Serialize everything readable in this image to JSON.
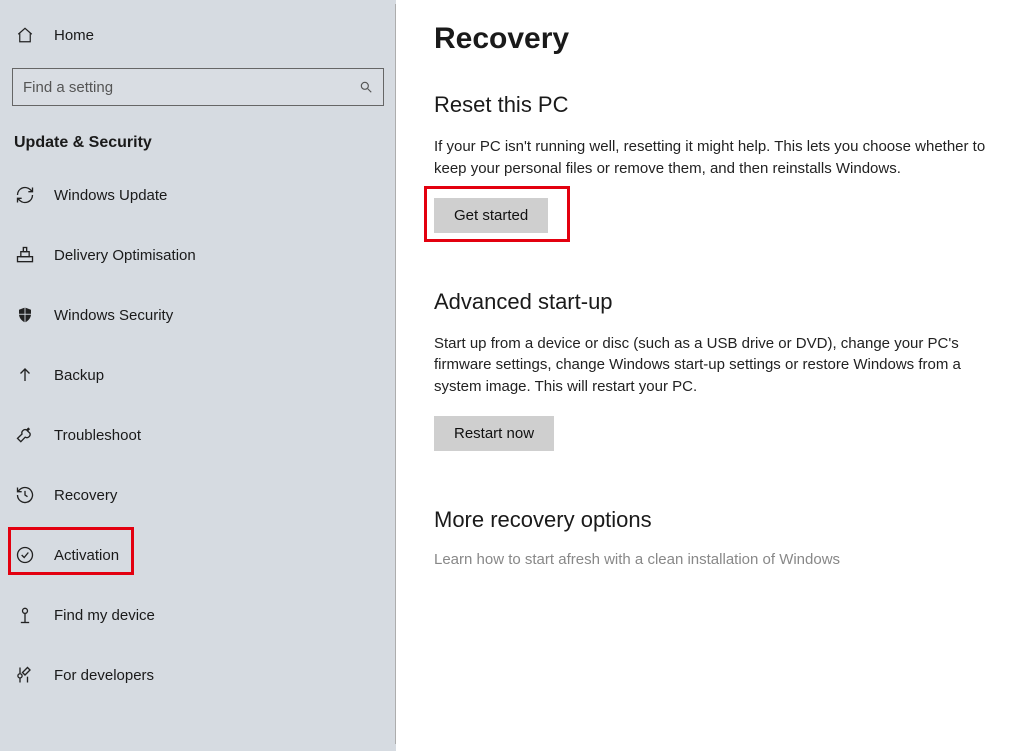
{
  "sidebar": {
    "home_label": "Home",
    "search_placeholder": "Find a setting",
    "category_title": "Update & Security",
    "items": [
      {
        "label": "Windows Update"
      },
      {
        "label": "Delivery Optimisation"
      },
      {
        "label": "Windows Security"
      },
      {
        "label": "Backup"
      },
      {
        "label": "Troubleshoot"
      },
      {
        "label": "Recovery"
      },
      {
        "label": "Activation"
      },
      {
        "label": "Find my device"
      },
      {
        "label": "For developers"
      }
    ]
  },
  "main": {
    "page_title": "Recovery",
    "reset": {
      "title": "Reset this PC",
      "desc": "If your PC isn't running well, resetting it might help. This lets you choose whether to keep your personal files or remove them, and then reinstalls Windows.",
      "button": "Get started"
    },
    "advanced": {
      "title": "Advanced start-up",
      "desc": "Start up from a device or disc (such as a USB drive or DVD), change your PC's firmware settings, change Windows start-up settings or restore Windows from a system image. This will restart your PC.",
      "button": "Restart now"
    },
    "more": {
      "title": "More recovery options",
      "link": "Learn how to start afresh with a clean installation of Windows"
    }
  }
}
